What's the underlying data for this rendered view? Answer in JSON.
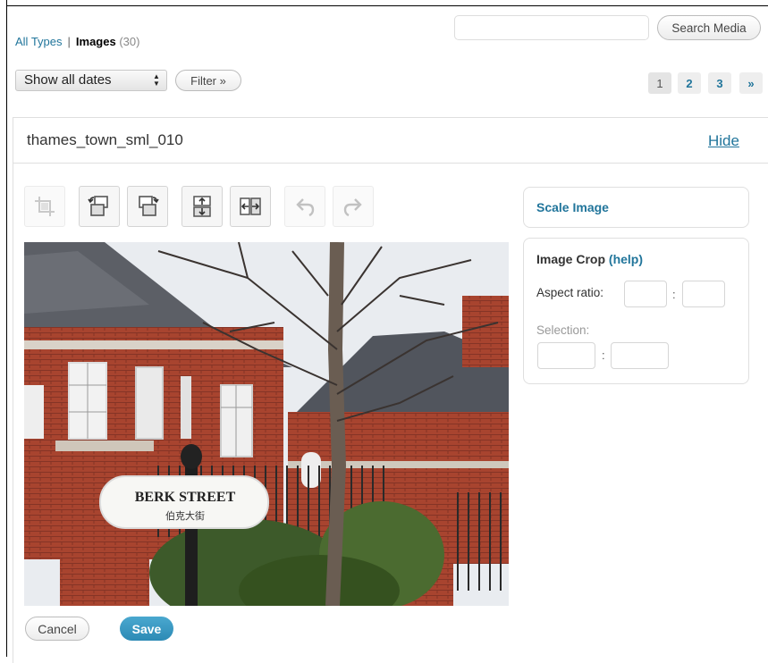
{
  "type_filter": {
    "all_types": "All Types",
    "separator": "|",
    "images": "Images",
    "images_count": "(30)"
  },
  "search": {
    "value": "",
    "button_label": "Search Media"
  },
  "date_filter": {
    "selected": "Show all dates"
  },
  "filter_button": "Filter »",
  "pagination": [
    "1",
    "2",
    "3",
    "»"
  ],
  "item": {
    "filename": "thames_town_sml_010",
    "hide_label": "Hide"
  },
  "toolbar": {
    "icons": [
      "crop-icon",
      "rotate-left-icon",
      "rotate-right-icon",
      "flip-vertical-icon",
      "flip-horizontal-icon",
      "undo-icon",
      "redo-icon"
    ]
  },
  "image": {
    "sign_line1": "BERK STREET",
    "sign_line2": "伯克大街"
  },
  "side_panel": {
    "scale_title": "Scale Image",
    "crop_title": "Image Crop",
    "crop_help": "(help)",
    "aspect_label": "Aspect ratio:",
    "aspect_w": "",
    "aspect_h": "",
    "colon": ":",
    "selection_label": "Selection:",
    "sel_w": "",
    "sel_h": ""
  },
  "actions": {
    "cancel": "Cancel",
    "save": "Save"
  },
  "colors": {
    "link": "#21759b",
    "save_button": "#2e8fbc"
  }
}
